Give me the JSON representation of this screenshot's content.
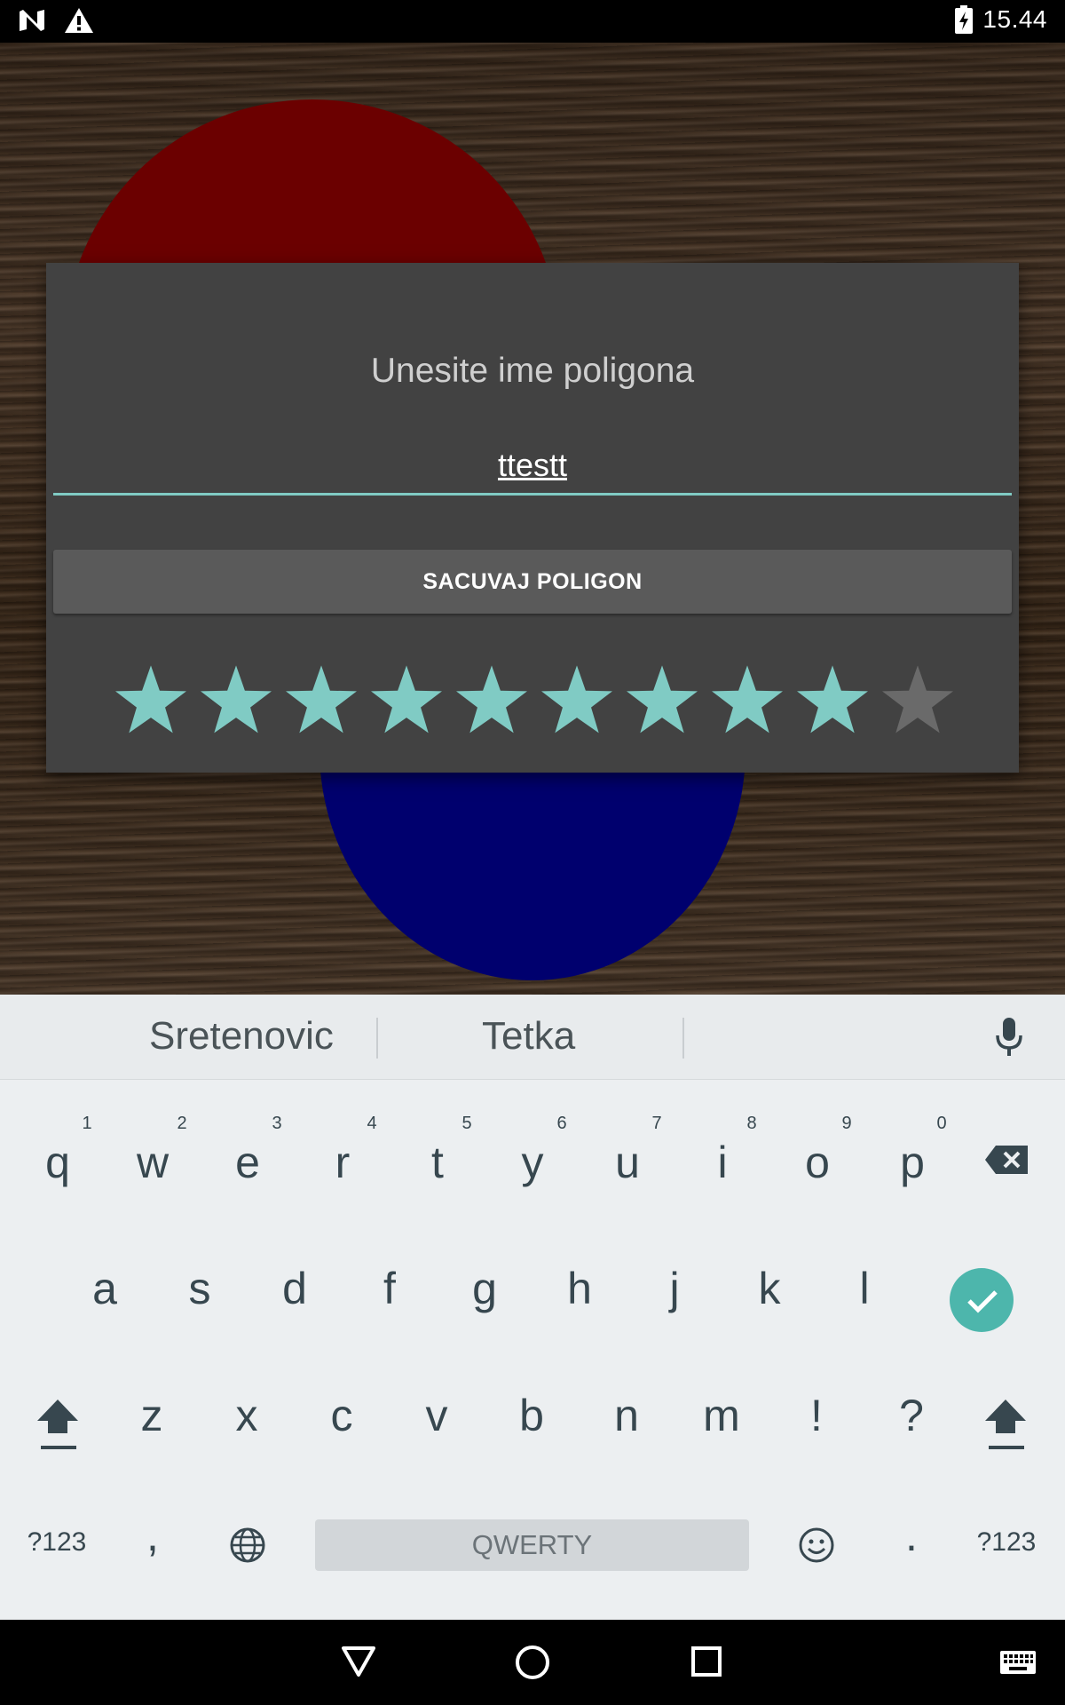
{
  "status_bar": {
    "time": "15.44",
    "icons": [
      "notification-n-icon",
      "warning-icon",
      "battery-charging-icon"
    ]
  },
  "dialog": {
    "title": "Unesite ime poligona",
    "name_input_value": "ttestt",
    "save_button_label": "SACUVAJ POLIGON",
    "rating": {
      "value": 9,
      "max": 10,
      "filled_color": "#80cbc4",
      "empty_color": "#6a6a6a"
    }
  },
  "background": {
    "red_circle_color": "#6b0000",
    "blue_circle_color": "#00006e"
  },
  "keyboard": {
    "suggestions": [
      "Sretenovic",
      "Tetka"
    ],
    "row1": [
      "q",
      "w",
      "e",
      "r",
      "t",
      "y",
      "u",
      "i",
      "o",
      "p"
    ],
    "row1_hints": [
      "1",
      "2",
      "3",
      "4",
      "5",
      "6",
      "7",
      "8",
      "9",
      "0"
    ],
    "row2": [
      "a",
      "s",
      "d",
      "f",
      "g",
      "h",
      "j",
      "k",
      "l"
    ],
    "row3": [
      "z",
      "x",
      "c",
      "v",
      "b",
      "n",
      "m",
      "!",
      "?"
    ],
    "symbols_label": "?123",
    "comma": ",",
    "space_label": "QWERTY",
    "period": ".",
    "accent_color": "#4db6ac"
  },
  "nav_bar": {
    "icons": [
      "back-icon",
      "home-icon",
      "recents-icon",
      "keyboard-switch-icon"
    ]
  }
}
